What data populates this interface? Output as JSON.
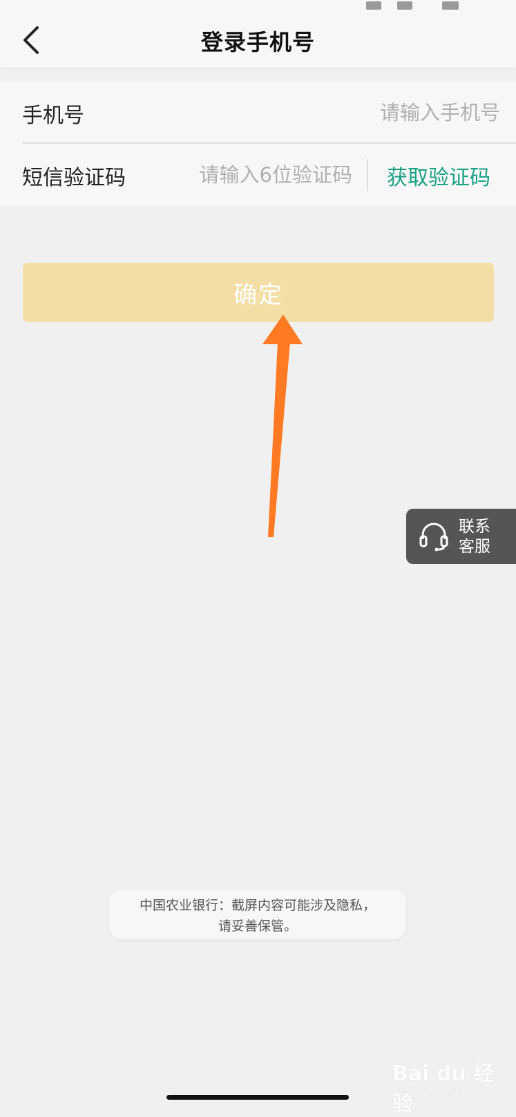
{
  "header": {
    "title": "登录手机号",
    "back_icon": "chevron-left-icon"
  },
  "form": {
    "phone": {
      "label": "手机号",
      "placeholder": "请输入手机号"
    },
    "code": {
      "label": "短信验证码",
      "placeholder": "请输入6位验证码",
      "get_code_label": "获取验证码"
    }
  },
  "confirm_button": {
    "label": "确定"
  },
  "service": {
    "line1": "联系",
    "line2": "客服",
    "icon": "headset-icon"
  },
  "toast": {
    "line1": "中国农业银行：截屏内容可能涉及隐私，",
    "line2": "请妥善保管。"
  },
  "colors": {
    "accent_green": "#1aa184",
    "confirm_button_bg": "#f3dea6",
    "annotation_arrow": "#ff7a22"
  }
}
